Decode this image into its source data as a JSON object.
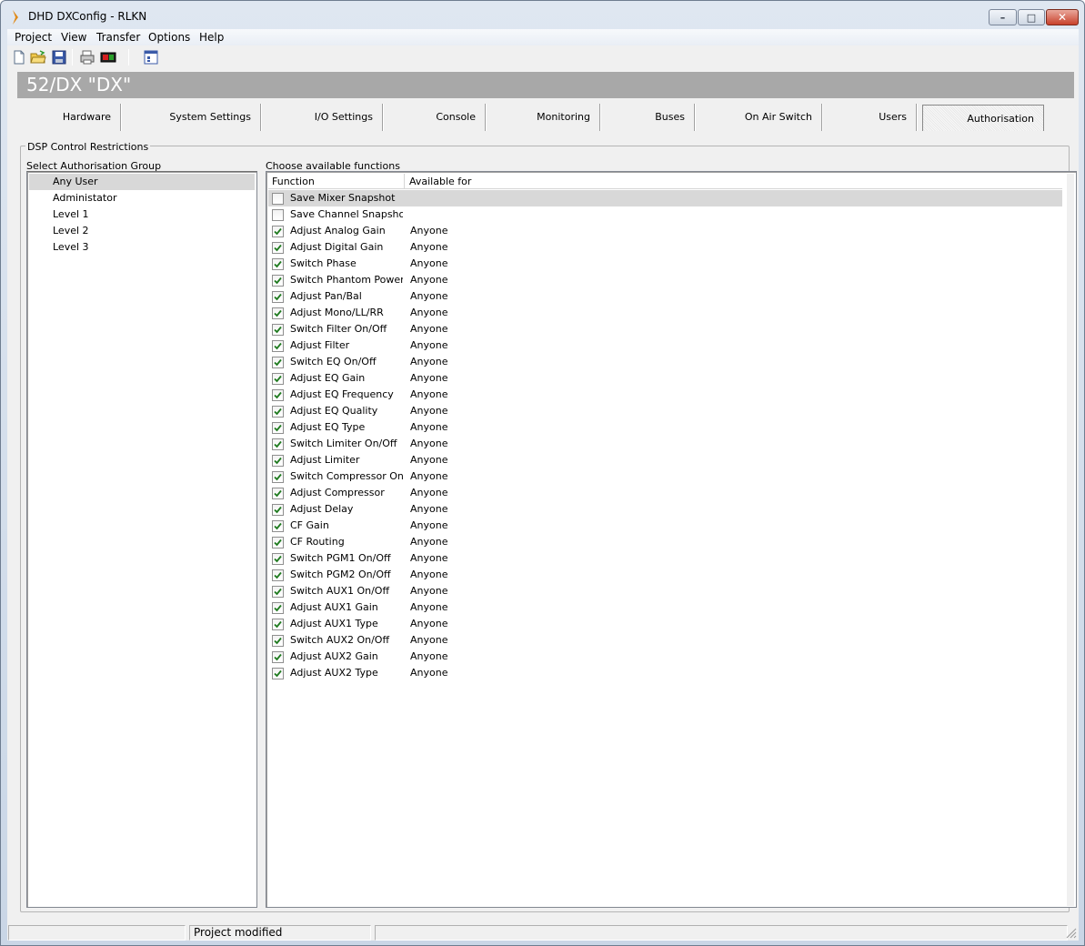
{
  "window": {
    "title": "DHD DXConfig - RLKN",
    "minimize": "–",
    "maximize": "□",
    "close": "✕"
  },
  "menu": [
    "Project",
    "View",
    "Transfer",
    "Options",
    "Help"
  ],
  "toolbar": [
    "new-file-icon",
    "open-folder-icon",
    "save-icon",
    "print-icon",
    "transfer-icon",
    "properties-icon"
  ],
  "device": {
    "name": "52/DX \"DX\""
  },
  "tabs": [
    "Hardware",
    "System Settings",
    "I/O Settings",
    "Console",
    "Monitoring",
    "Buses",
    "On Air Switch",
    "Users",
    "Authorisation"
  ],
  "active_tab": "Authorisation",
  "group": {
    "title": "DSP Control Restrictions"
  },
  "left": {
    "label": "Select Authorisation Group",
    "items": [
      "Any User",
      "Administator",
      "Level 1",
      "Level 2",
      "Level 3"
    ],
    "selected": "Any User"
  },
  "right": {
    "label": "Choose available functions",
    "columns": {
      "function": "Function",
      "available": "Available for"
    },
    "rows": [
      {
        "name": "Save Mixer Snapshot",
        "checked": false,
        "available": ""
      },
      {
        "name": "Save Channel Snapshot",
        "checked": false,
        "available": ""
      },
      {
        "name": "Adjust Analog Gain",
        "checked": true,
        "available": "Anyone"
      },
      {
        "name": "Adjust Digital Gain",
        "checked": true,
        "available": "Anyone"
      },
      {
        "name": "Switch Phase",
        "checked": true,
        "available": "Anyone"
      },
      {
        "name": "Switch Phantom Power",
        "checked": true,
        "available": "Anyone"
      },
      {
        "name": "Adjust Pan/Bal",
        "checked": true,
        "available": "Anyone"
      },
      {
        "name": "Adjust Mono/LL/RR",
        "checked": true,
        "available": "Anyone"
      },
      {
        "name": "Switch Filter On/Off",
        "checked": true,
        "available": "Anyone"
      },
      {
        "name": "Adjust Filter",
        "checked": true,
        "available": "Anyone"
      },
      {
        "name": "Switch EQ On/Off",
        "checked": true,
        "available": "Anyone"
      },
      {
        "name": "Adjust EQ Gain",
        "checked": true,
        "available": "Anyone"
      },
      {
        "name": "Adjust EQ Frequency",
        "checked": true,
        "available": "Anyone"
      },
      {
        "name": "Adjust EQ Quality",
        "checked": true,
        "available": "Anyone"
      },
      {
        "name": "Adjust EQ Type",
        "checked": true,
        "available": "Anyone"
      },
      {
        "name": "Switch Limiter On/Off",
        "checked": true,
        "available": "Anyone"
      },
      {
        "name": "Adjust Limiter",
        "checked": true,
        "available": "Anyone"
      },
      {
        "name": "Switch Compressor On...",
        "checked": true,
        "available": "Anyone"
      },
      {
        "name": "Adjust Compressor",
        "checked": true,
        "available": "Anyone"
      },
      {
        "name": "Adjust Delay",
        "checked": true,
        "available": "Anyone"
      },
      {
        "name": "CF Gain",
        "checked": true,
        "available": "Anyone"
      },
      {
        "name": "CF Routing",
        "checked": true,
        "available": "Anyone"
      },
      {
        "name": "Switch PGM1 On/Off",
        "checked": true,
        "available": "Anyone"
      },
      {
        "name": "Switch PGM2 On/Off",
        "checked": true,
        "available": "Anyone"
      },
      {
        "name": "Switch AUX1 On/Off",
        "checked": true,
        "available": "Anyone"
      },
      {
        "name": "Adjust AUX1 Gain",
        "checked": true,
        "available": "Anyone"
      },
      {
        "name": "Adjust AUX1 Type",
        "checked": true,
        "available": "Anyone"
      },
      {
        "name": "Switch AUX2 On/Off",
        "checked": true,
        "available": "Anyone"
      },
      {
        "name": "Adjust AUX2 Gain",
        "checked": true,
        "available": "Anyone"
      },
      {
        "name": "Adjust AUX2 Type",
        "checked": true,
        "available": "Anyone"
      }
    ],
    "highlighted_row": "Save Mixer Snapshot"
  },
  "status": {
    "message": "Project modified"
  },
  "colors": {
    "banner": "#a8a8a8",
    "check": "#1e7a1e",
    "selection": "#d8d8d8"
  }
}
